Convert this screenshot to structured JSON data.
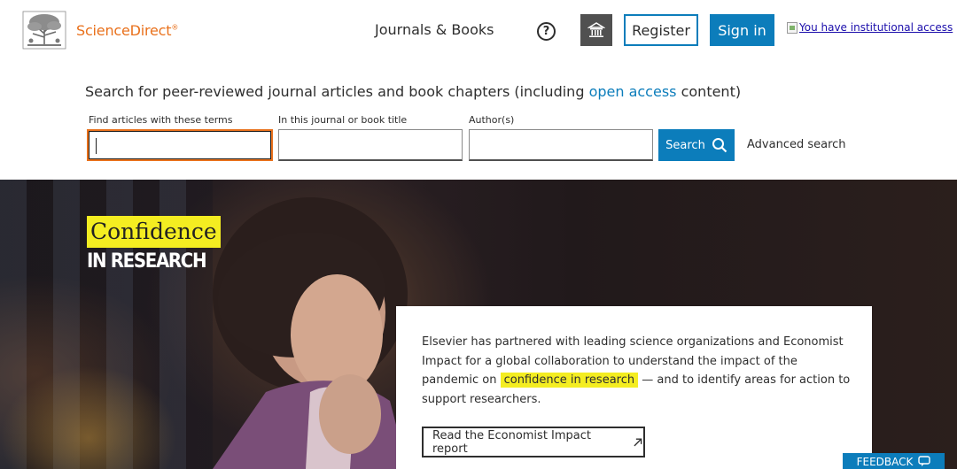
{
  "header": {
    "brand": "ScienceDirect",
    "brand_suffix": "®",
    "nav_journals": "Journals & Books",
    "help_symbol": "?",
    "register_label": "Register",
    "signin_label": "Sign in",
    "institutional_access": "You have institutional access",
    "icons": [
      "elsevier-tree-logo",
      "help-icon",
      "institution-icon",
      "broken-image-icon"
    ]
  },
  "search": {
    "headline_prefix": "Search for peer-reviewed journal articles and book chapters (including ",
    "headline_link": "open access",
    "headline_suffix": " content)",
    "fields": [
      {
        "label": "Find articles with these terms",
        "value": ""
      },
      {
        "label": "In this journal or book title",
        "value": ""
      },
      {
        "label": "Author(s)",
        "value": ""
      }
    ],
    "button_label": "Search",
    "advanced_label": "Advanced search"
  },
  "hero": {
    "title_word": "Confidence",
    "title_sub": "IN RESEARCH",
    "body_prefix": "Elsevier has partnered with leading science organizations and Economist Impact for a global collaboration to understand the impact of the pandemic on ",
    "body_highlight": "confidence in research",
    "body_suffix": " — and to identify areas for action to support researchers.",
    "report_button": "Read the Economist Impact report"
  },
  "feedback": {
    "label": "FEEDBACK"
  },
  "colors": {
    "accent_blue": "#0c7dbb",
    "brand_orange": "#e9711c",
    "highlight_yellow": "#f4ed21"
  }
}
